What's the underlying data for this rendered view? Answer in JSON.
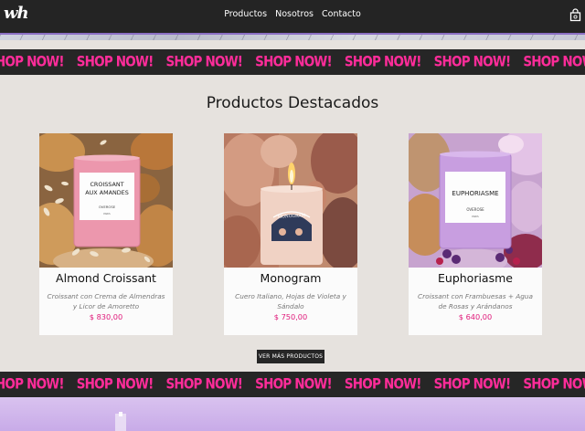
{
  "nav": {
    "logo": "wh",
    "links": [
      "Productos",
      "Nosotros",
      "Contacto"
    ]
  },
  "ticker": {
    "text": "SHOP NOW!",
    "count": 9
  },
  "section": {
    "title": "Productos Destacados"
  },
  "products": [
    {
      "name": "Almond Croissant",
      "desc": "Croissant con Crema de Almendras y Licor de Amoretto",
      "price": "$ 830,00",
      "label_line1": "CROISSANT",
      "label_line2": "AUX AMANDES",
      "label_brand": "OVEROSE",
      "label_city": "PARIS"
    },
    {
      "name": "Monogram",
      "desc": "Cuero Italiano, Hojas de Violeta y Sándalo",
      "price": "$ 750,00"
    },
    {
      "name": "Euphoriasme",
      "desc": "Croissant con Frambuesas + Agua de Rosas y Arándanos",
      "price": "$ 640,00",
      "label_line1": "EUPHORIASME",
      "label_brand": "OVEROSE",
      "label_city": "PARIS"
    }
  ],
  "button": {
    "label": "VER MÁS PRODUCTOS"
  },
  "colors": {
    "nav_bg": "#242424",
    "accent_pink": "#ff2c9a",
    "price_pink": "#e0197a",
    "page_bg": "#e6e2de"
  },
  "icons": {
    "cart": "shopping-bag-icon"
  }
}
